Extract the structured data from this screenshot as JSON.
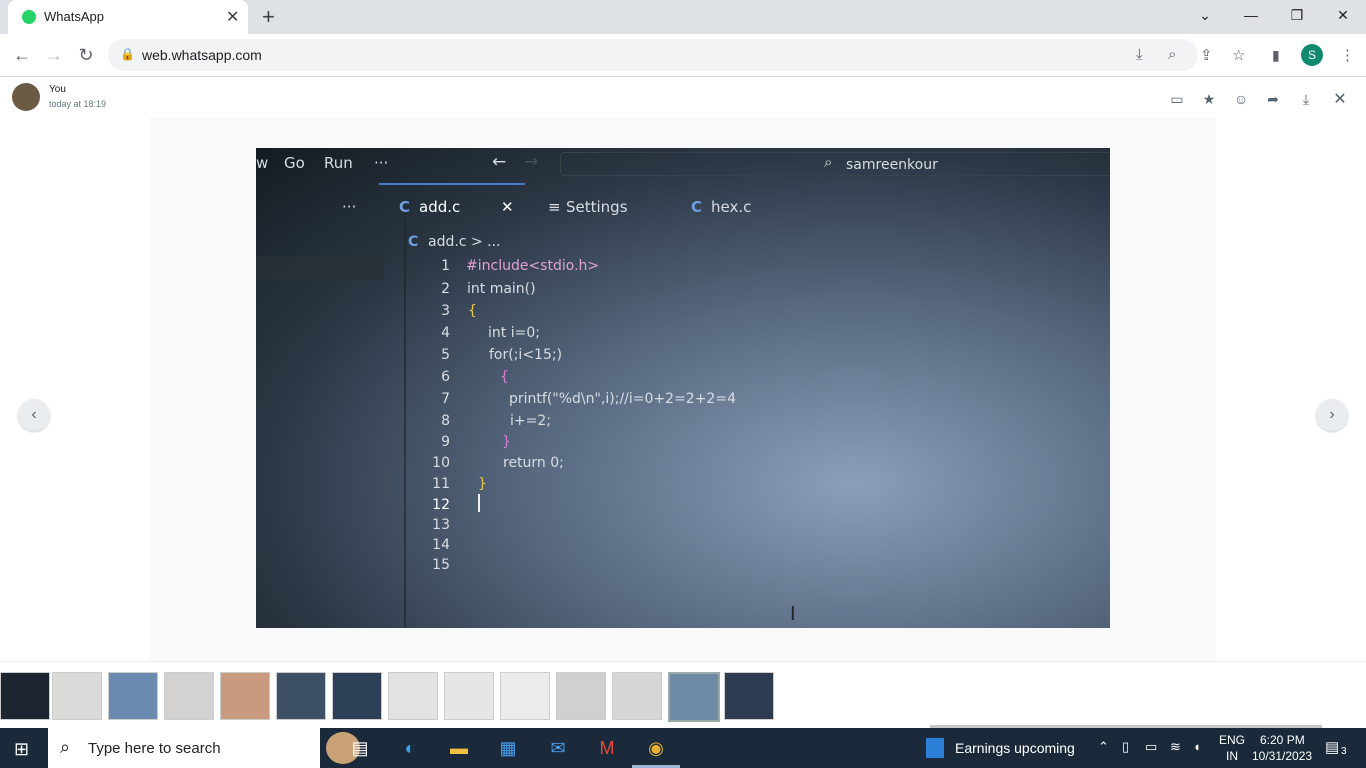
{
  "browser": {
    "tab_title": "WhatsApp",
    "tab_close": "✕",
    "new_tab": "+",
    "url": "web.whatsapp.com",
    "profile_initial": "S",
    "window_controls": [
      "⌄",
      "—",
      "❐",
      "✕"
    ]
  },
  "viewer": {
    "sender": "You",
    "timestamp": "today at 18:19",
    "prev_label": "‹",
    "next_label": "›"
  },
  "photo": {
    "menu": [
      "w",
      "Go",
      "Run",
      "···"
    ],
    "search_text": "samreenkour",
    "tabs": [
      {
        "icon": "C",
        "label": "add.c",
        "close": "✕"
      },
      {
        "icon": "≡",
        "label": "Settings"
      },
      {
        "icon": "C",
        "label": "hex.c"
      }
    ],
    "more": "···",
    "breadcrumb": "add.c > ...",
    "breadcrumb_icon": "C",
    "line_numbers": [
      "1",
      "2",
      "3",
      "4",
      "5",
      "6",
      "7",
      "8",
      "9",
      "10",
      "11",
      "12",
      "13",
      "14",
      "15"
    ],
    "code_lines": [
      "#include<stdio.h>",
      "int main()",
      "{",
      "int i=0;",
      "for(;i<15;)",
      "{",
      "printf(\"%d\\n\",i);//i=0+2=2+2=4",
      "i+=2;",
      "}",
      "return 0;",
      "}"
    ]
  },
  "taskbar": {
    "search_placeholder": "Type here to search",
    "weather_text": "Earnings upcoming",
    "lang_line1": "ENG",
    "lang_line2": "IN",
    "time": "6:20 PM",
    "date": "10/31/2023",
    "notifications": "3"
  }
}
